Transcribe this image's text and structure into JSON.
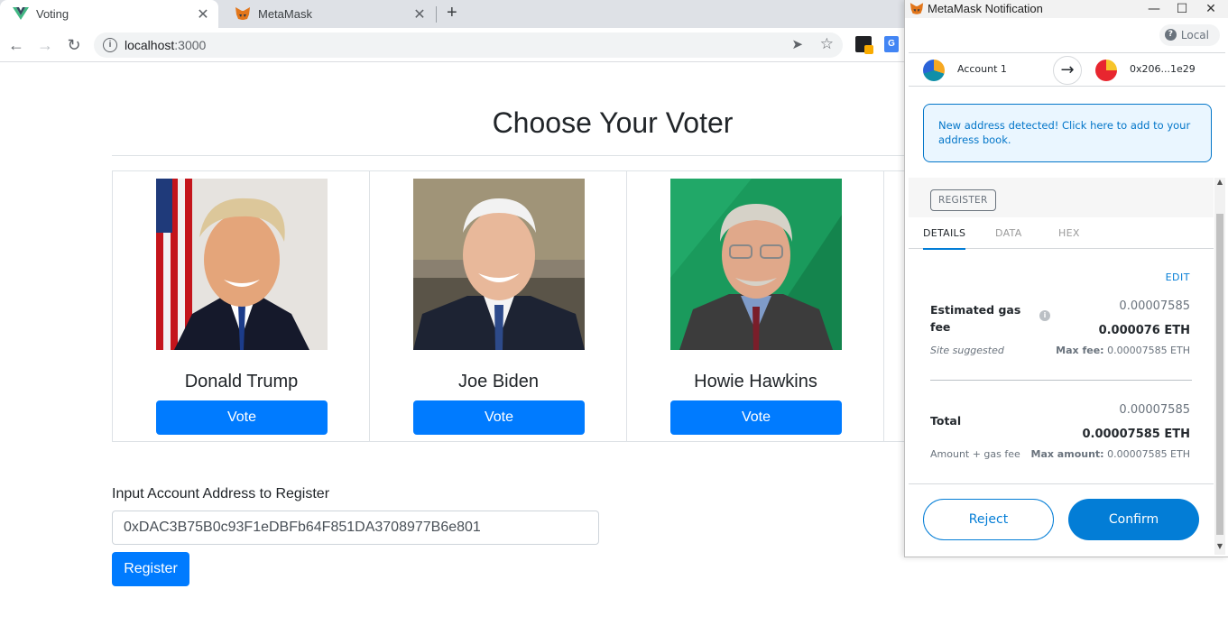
{
  "browser": {
    "tabs": [
      {
        "title": "Voting",
        "icon": "vue-icon"
      },
      {
        "title": "MetaMask",
        "icon": "metamask-fox-icon"
      }
    ],
    "url_host": "localhost",
    "url_port": ":3000"
  },
  "page": {
    "title": "Choose Your Voter",
    "candidates": [
      {
        "name": "Donald Trump",
        "vote_label": "Vote"
      },
      {
        "name": "Joe Biden",
        "vote_label": "Vote"
      },
      {
        "name": "Howie Hawkins",
        "vote_label": "Vote"
      }
    ],
    "register": {
      "label": "Input Account Address to Register",
      "value": "0xDAC3B75B0c93F1eDBFb64F851DA3708977B6e801",
      "button_label": "Register"
    }
  },
  "metamask": {
    "window_title": "MetaMask Notification",
    "network": "Local",
    "from_account": "Account 1",
    "to_account": "0x206...1e29",
    "alert": "New address detected! Click here to add to your address book.",
    "method_label": "REGISTER",
    "tabs": [
      "DETAILS",
      "DATA",
      "HEX"
    ],
    "edit_label": "EDIT",
    "gas": {
      "label": "Estimated gas fee",
      "secondary": "0.00007585",
      "primary": "0.000076 ETH",
      "site_suggested": "Site suggested",
      "max_fee_label": "Max fee:",
      "max_fee_value": "0.00007585 ETH"
    },
    "total": {
      "label": "Total",
      "secondary": "0.00007585",
      "primary": "0.00007585 ETH",
      "amount_gas": "Amount + gas fee",
      "max_amount_label": "Max amount:",
      "max_amount_value": "0.00007585 ETH"
    },
    "reject_label": "Reject",
    "confirm_label": "Confirm",
    "accent_color": "#037dd6"
  }
}
